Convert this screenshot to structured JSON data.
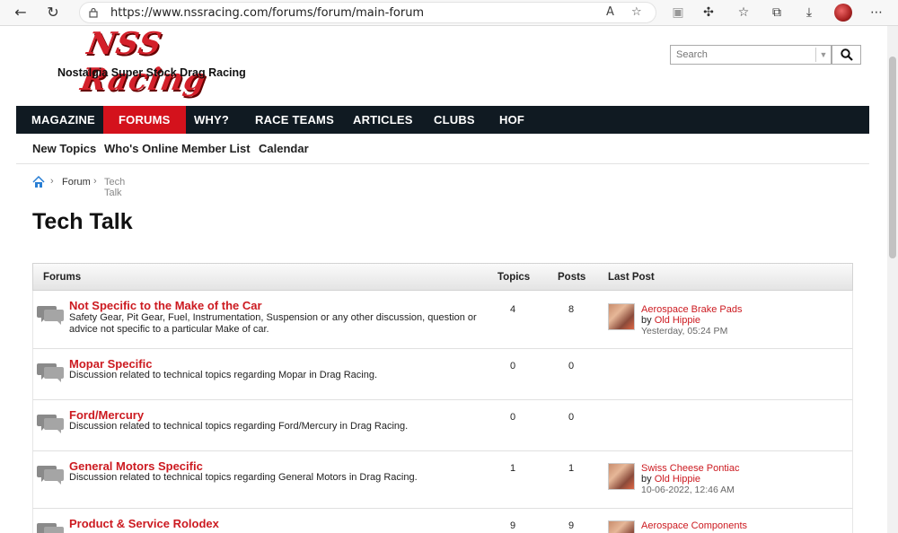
{
  "browser": {
    "url": "https://www.nssracing.com/forums/forum/main-forum"
  },
  "site": {
    "logo_text": "NSS Racing",
    "tagline": "Nostalgia Super Stock Drag Racing"
  },
  "search": {
    "placeholder": "Search"
  },
  "mainnav": [
    "MAGAZINE",
    "FORUMS",
    "WHY?",
    "RACE TEAMS",
    "ARTICLES",
    "CLUBS",
    "HOF"
  ],
  "subnav": [
    "New Topics",
    "Who's Online",
    "Member List",
    "Calendar"
  ],
  "breadcrumb": {
    "forum": "Forum",
    "current": "Tech Talk"
  },
  "page_title": "Tech Talk",
  "table": {
    "headers": {
      "forums": "Forums",
      "topics": "Topics",
      "posts": "Posts",
      "last_post": "Last Post"
    },
    "rows": [
      {
        "title": "Not Specific to the Make of the Car",
        "desc": "Safety Gear, Pit Gear, Fuel, Instrumentation, Suspension or any other discussion, question or advice not specific to a particular Make of car.",
        "topics": "4",
        "posts": "8",
        "last_post": {
          "title": "Aerospace Brake Pads",
          "by": "by ",
          "user": "Old Hippie",
          "time": "Yesterday, 05:24 PM"
        }
      },
      {
        "title": "Mopar Specific",
        "desc": "Discussion related to technical topics regarding Mopar in Drag Racing.",
        "topics": "0",
        "posts": "0"
      },
      {
        "title": "Ford/Mercury",
        "desc": "Discussion related to technical topics regarding Ford/Mercury in Drag Racing.",
        "topics": "0",
        "posts": "0"
      },
      {
        "title": "General Motors Specific",
        "desc": "Discussion related to technical topics regarding General Motors in Drag Racing.",
        "topics": "1",
        "posts": "1",
        "last_post": {
          "title": "Swiss Cheese Pontiac",
          "by": "by ",
          "user": "Old Hippie",
          "time": "10-06-2022, 12:46 AM"
        }
      },
      {
        "title": "Product & Service Rolodex",
        "desc": "",
        "topics": "9",
        "posts": "9",
        "last_post": {
          "title": "Aerospace Components"
        }
      }
    ]
  }
}
